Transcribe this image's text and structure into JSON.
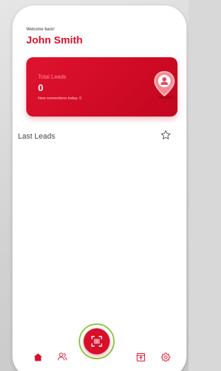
{
  "header": {
    "greeting": "Welcome back!",
    "user_name": "John Smith"
  },
  "leads_card": {
    "title": "Total Leads",
    "count": "0",
    "subtitle": "New connections today: 0",
    "icon": "location-pin-user-icon"
  },
  "last_leads": {
    "title": "Last Leads",
    "icon": "star-icon",
    "items": []
  },
  "bottom_nav": {
    "items": [
      {
        "icon": "home-icon",
        "active": true
      },
      {
        "icon": "users-icon",
        "active": false
      },
      {
        "icon": "barcode-scan-icon",
        "active": false
      },
      {
        "icon": "export-icon",
        "active": false
      },
      {
        "icon": "gear-icon",
        "active": false
      }
    ]
  },
  "colors": {
    "brand_red": "#d90f2a",
    "highlight_green": "#8dc63f"
  }
}
